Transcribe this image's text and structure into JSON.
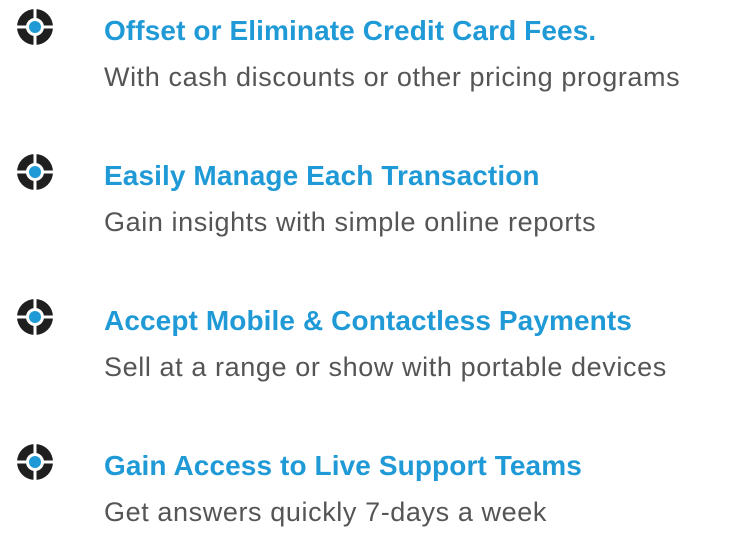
{
  "features": [
    {
      "icon": "crosshair-bullet-icon",
      "title": "Offset or Eliminate Credit Card Fees.",
      "description": "With cash discounts or other pricing programs"
    },
    {
      "icon": "crosshair-bullet-icon",
      "title": "Easily Manage Each Transaction",
      "description": "Gain insights with simple online reports"
    },
    {
      "icon": "crosshair-bullet-icon",
      "title": "Accept Mobile & Contactless Payments",
      "description": "Sell at a range or show with portable devices"
    },
    {
      "icon": "crosshair-bullet-icon",
      "title": "Gain Access to Live Support Teams",
      "description": "Get answers quickly 7-days a week"
    }
  ],
  "colors": {
    "title": "#1f9ad6",
    "description": "#555555",
    "icon_ring": "#1f1f1f",
    "icon_center": "#1f9ad6"
  }
}
